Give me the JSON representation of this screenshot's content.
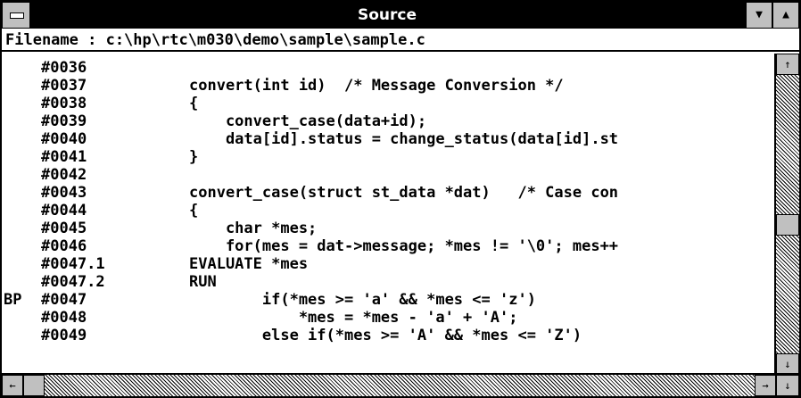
{
  "window": {
    "title": "Source",
    "filename_label": "Filename : c:\\hp\\rtc\\m030\\demo\\sample\\sample.c"
  },
  "icons": {
    "system_menu": "system-menu-icon",
    "minimize": "▼",
    "maximize": "▲",
    "scroll_up": "↑",
    "scroll_down": "↓",
    "scroll_left": "←",
    "scroll_right": "→"
  },
  "lines": [
    {
      "bp": "",
      "num": "#0036",
      "code": ""
    },
    {
      "bp": "",
      "num": "#0037",
      "code": "convert(int id)  /* Message Conversion */"
    },
    {
      "bp": "",
      "num": "#0038",
      "code": "{"
    },
    {
      "bp": "",
      "num": "#0039",
      "code": "    convert_case(data+id);"
    },
    {
      "bp": "",
      "num": "#0040",
      "code": "    data[id].status = change_status(data[id].st"
    },
    {
      "bp": "",
      "num": "#0041",
      "code": "}"
    },
    {
      "bp": "",
      "num": "#0042",
      "code": ""
    },
    {
      "bp": "",
      "num": "#0043",
      "code": "convert_case(struct st_data *dat)   /* Case con"
    },
    {
      "bp": "",
      "num": "#0044",
      "code": "{"
    },
    {
      "bp": "",
      "num": "#0045",
      "code": "    char *mes;"
    },
    {
      "bp": "",
      "num": "#0046",
      "code": "    for(mes = dat->message; *mes != '\\0'; mes++"
    },
    {
      "bp": "",
      "num": "#0047.1",
      "code": "EVALUATE *mes"
    },
    {
      "bp": "",
      "num": "#0047.2",
      "code": "RUN"
    },
    {
      "bp": "BP",
      "num": "#0047",
      "code": "        if(*mes >= 'a' && *mes <= 'z')"
    },
    {
      "bp": "",
      "num": "#0048",
      "code": "            *mes = *mes - 'a' + 'A';"
    },
    {
      "bp": "",
      "num": "#0049",
      "code": "        else if(*mes >= 'A' && *mes <= 'Z')"
    }
  ]
}
